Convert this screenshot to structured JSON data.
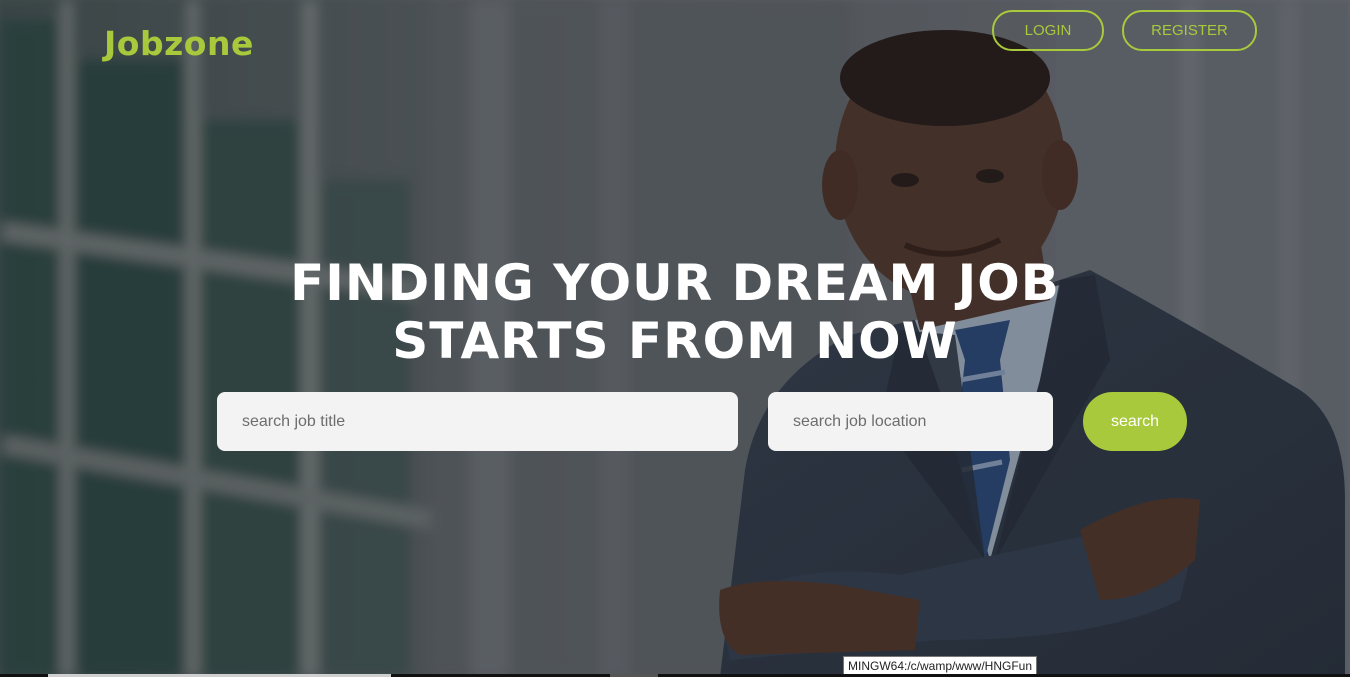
{
  "brand": {
    "logo_text": "Jobzone",
    "accent_color": "#a9c93c"
  },
  "nav": {
    "login_label": "LOGIN",
    "register_label": "REGISTER"
  },
  "hero": {
    "headline_line1": "FINDING YOUR DREAM JOB",
    "headline_line2": "STARTS FROM NOW",
    "background_image": "businessman-in-suit-with-arms-crossed-photo"
  },
  "search": {
    "title_placeholder": "search job title",
    "location_placeholder": "search job location",
    "button_label": "search"
  },
  "system": {
    "tooltip_text": "MINGW64:/c/wamp/www/HNGFun"
  }
}
